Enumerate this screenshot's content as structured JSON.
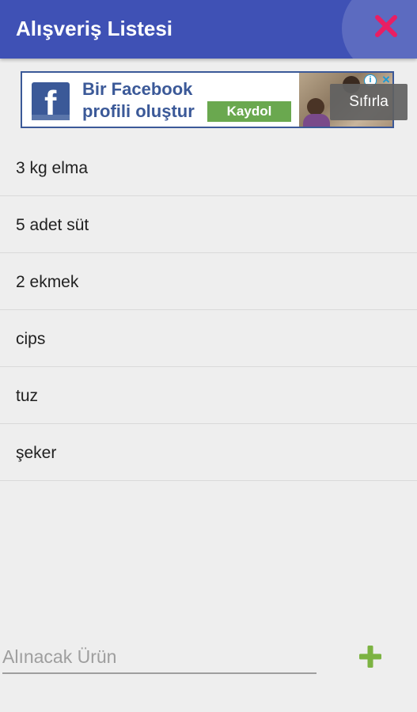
{
  "app": {
    "title": "Alışveriş Listesi"
  },
  "toolbar": {
    "close_icon": "close-icon",
    "close_color": "#e91e63",
    "bar_color": "#3f51b5"
  },
  "ad": {
    "line1": "Bir Facebook",
    "line2": "profili oluştur",
    "cta": "Kaydol",
    "logo_letter": "f",
    "info_glyph": "i",
    "close_glyph": "×"
  },
  "tooltip": {
    "label": "Sıfırla"
  },
  "items": [
    {
      "label": "3 kg elma"
    },
    {
      "label": "5 adet süt"
    },
    {
      "label": "2 ekmek"
    },
    {
      "label": "cips"
    },
    {
      "label": "tuz"
    },
    {
      "label": "şeker"
    }
  ],
  "input": {
    "placeholder": "Alınacak Ürün",
    "value": ""
  },
  "add_button": {
    "icon": "plus-icon",
    "color": "#7cb342"
  }
}
